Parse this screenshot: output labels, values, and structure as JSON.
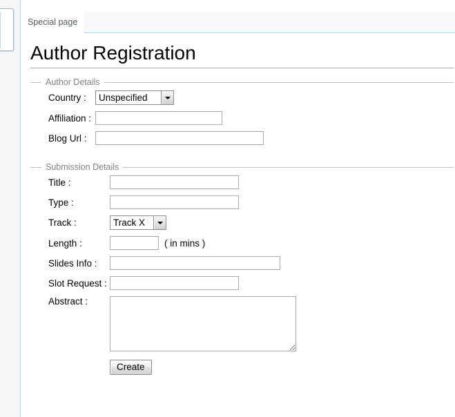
{
  "window": {
    "background_color": "#ffffff",
    "gutter_color": "#f6f6f6",
    "accent_border_color": "#a7d7f9"
  },
  "tabs": [
    {
      "label": "Special page",
      "active": true
    }
  ],
  "page": {
    "title": "Author Registration"
  },
  "form": {
    "sections": [
      {
        "legend": "Author Details",
        "fields": [
          {
            "label": "Country :",
            "type": "select",
            "value": "Unspecified",
            "options": [
              "Unspecified"
            ]
          },
          {
            "label": "Affiliation :",
            "type": "text",
            "value": "",
            "placeholder": ""
          },
          {
            "label": "Blog Url :",
            "type": "text",
            "value": "",
            "placeholder": ""
          }
        ]
      },
      {
        "legend": "Submission Details",
        "fields": [
          {
            "label": "Title :",
            "type": "text",
            "value": "",
            "placeholder": ""
          },
          {
            "label": "Type :",
            "type": "text",
            "value": "",
            "placeholder": ""
          },
          {
            "label": "Track :",
            "type": "select",
            "value": "Track X",
            "options": [
              "Track X"
            ]
          },
          {
            "label": "Length :",
            "type": "text",
            "value": "",
            "placeholder": "",
            "suffix": "( in mins )"
          },
          {
            "label": "Slides Info :",
            "type": "text",
            "value": "",
            "placeholder": ""
          },
          {
            "label": "Slot Request :",
            "type": "text",
            "value": "",
            "placeholder": ""
          },
          {
            "label": "Abstract :",
            "type": "textarea",
            "value": "",
            "placeholder": ""
          }
        ]
      }
    ],
    "submit": {
      "label": "Create"
    }
  }
}
